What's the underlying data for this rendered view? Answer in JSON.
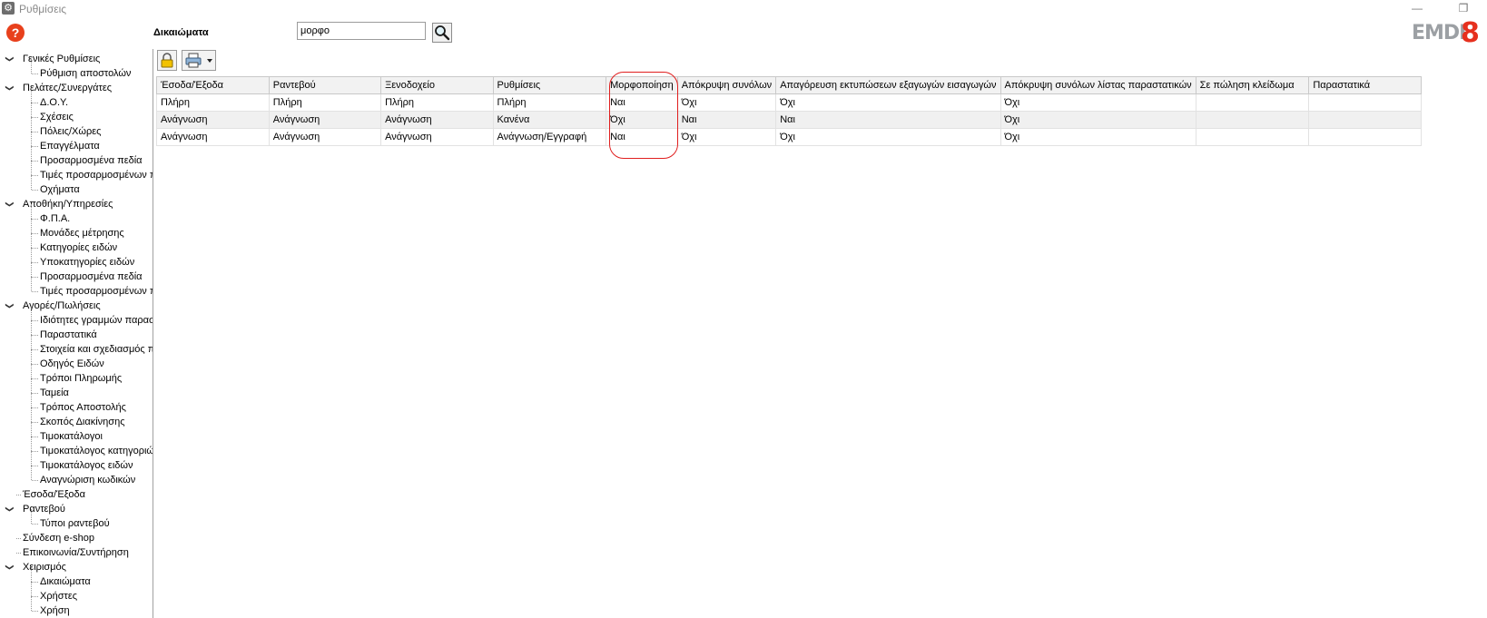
{
  "window": {
    "title": "Ρυθμίσεις",
    "minimize_label": "—",
    "restore_label": "❐"
  },
  "header": {
    "help_label": "?",
    "page_title": "Δικαιώματα",
    "search_value": "μορφο",
    "logo_text": "EMDI",
    "logo_number": "8"
  },
  "colors": {
    "accent": "#e6301e",
    "highlight": "#e01e1e"
  },
  "icons": {
    "search": "search-icon",
    "lock": "lock-icon",
    "print": "printer-icon",
    "dropdown": "chevron-down-icon",
    "settings": "gear-icon"
  },
  "sidebar": {
    "items": [
      {
        "label": "Γενικές Ρυθμίσεις",
        "level": 0,
        "expandable": true
      },
      {
        "label": "Ρύθμιση αποστολών",
        "level": 1
      },
      {
        "label": "Πελάτες/Συνεργάτες",
        "level": 0,
        "expandable": true
      },
      {
        "label": "Δ.Ο.Υ.",
        "level": 1
      },
      {
        "label": "Σχέσεις",
        "level": 1
      },
      {
        "label": "Πόλεις/Χώρες",
        "level": 1
      },
      {
        "label": "Επαγγέλματα",
        "level": 1
      },
      {
        "label": "Προσαρμοσμένα πεδία",
        "level": 1
      },
      {
        "label": "Τιμές προσαρμοσμένων π",
        "level": 1
      },
      {
        "label": "Οχήματα",
        "level": 1
      },
      {
        "label": "Αποθήκη/Υπηρεσίες",
        "level": 0,
        "expandable": true
      },
      {
        "label": "Φ.Π.Α.",
        "level": 1
      },
      {
        "label": "Μονάδες μέτρησης",
        "level": 1
      },
      {
        "label": "Κατηγορίες ειδών",
        "level": 1
      },
      {
        "label": "Υποκατηγορίες ειδών",
        "level": 1
      },
      {
        "label": "Προσαρμοσμένα πεδία",
        "level": 1
      },
      {
        "label": "Τιμές προσαρμοσμένων π",
        "level": 1
      },
      {
        "label": "Αγορές/Πωλήσεις",
        "level": 0,
        "expandable": true
      },
      {
        "label": "Ιδιότητες γραμμών παρασ",
        "level": 1
      },
      {
        "label": "Παραστατικά",
        "level": 1
      },
      {
        "label": "Στοιχεία και σχεδιασμός π",
        "level": 1
      },
      {
        "label": "Οδηγός Ειδών",
        "level": 1
      },
      {
        "label": "Τρόποι Πληρωμής",
        "level": 1
      },
      {
        "label": "Ταμεία",
        "level": 1
      },
      {
        "label": "Τρόπος Αποστολής",
        "level": 1
      },
      {
        "label": "Σκοπός Διακίνησης",
        "level": 1
      },
      {
        "label": "Τιμοκατάλογοι",
        "level": 1
      },
      {
        "label": "Τιμοκατάλογος κατηγοριώ",
        "level": 1
      },
      {
        "label": "Τιμοκατάλογος ειδών",
        "level": 1
      },
      {
        "label": "Αναγνώριση κωδικών",
        "level": 1
      },
      {
        "label": "Έσοδα/Έξοδα",
        "level": 0
      },
      {
        "label": "Ραντεβού",
        "level": 0,
        "expandable": true
      },
      {
        "label": "Τύποι ραντεβού",
        "level": 1
      },
      {
        "label": "Σύνδεση e-shop",
        "level": 0
      },
      {
        "label": "Επικοινωνία/Συντήρηση",
        "level": 0
      },
      {
        "label": "Χειρισμός",
        "level": 0,
        "expandable": true
      },
      {
        "label": "Δικαιώματα",
        "level": 1
      },
      {
        "label": "Χρήστες",
        "level": 1
      },
      {
        "label": "Χρήση",
        "level": 1
      }
    ]
  },
  "grid": {
    "columns": [
      "Έσοδα/Έξοδα",
      "Ραντεβού",
      "Ξενοδοχείο",
      "Ρυθμίσεις",
      "Μορφοποίηση",
      "Απόκρυψη συνόλων",
      "Απαγόρευση εκτυπώσεων εξαγωγών εισαγωγών",
      "Απόκρυψη συνόλων λίστας παραστατικών",
      "Σε πώληση κλείδωμα",
      "Παραστατικά"
    ],
    "rows": [
      [
        "Πλήρη",
        "Πλήρη",
        "Πλήρη",
        "Πλήρη",
        "Ναι",
        "Όχι",
        "Όχι",
        "Όχι",
        "",
        ""
      ],
      [
        "Ανάγνωση",
        "Ανάγνωση",
        "Ανάγνωση",
        "Κανένα",
        "Όχι",
        "Ναι",
        "Ναι",
        "Όχι",
        "",
        ""
      ],
      [
        "Ανάγνωση",
        "Ανάγνωση",
        "Ανάγνωση",
        "Ανάγνωση/Εγγραφή",
        "Ναι",
        "Όχι",
        "Όχι",
        "Όχι",
        "",
        ""
      ]
    ]
  }
}
